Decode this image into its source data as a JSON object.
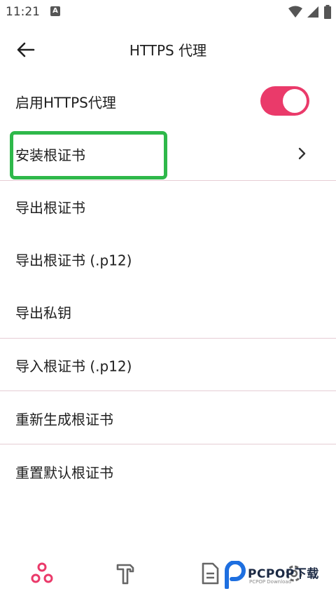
{
  "status": {
    "time": "11:21",
    "notif_letter": "A"
  },
  "header": {
    "title": "HTTPS 代理"
  },
  "settings": {
    "items": [
      {
        "label": "启用HTTPS代理"
      },
      {
        "label": "安装根证书"
      },
      {
        "label": "导出根证书"
      },
      {
        "label": "导出根证书 (.p12)"
      },
      {
        "label": "导出私钥"
      },
      {
        "label": "导入根证书 (.p12)"
      },
      {
        "label": "重新生成根证书"
      },
      {
        "label": "重置默认根证书"
      }
    ],
    "toggle_state": "on"
  },
  "colors": {
    "accent": "#ea3a6a",
    "highlight": "#2eb84a",
    "divider": "#e6cdd4"
  },
  "watermark": {
    "brand": "PCPOP下载",
    "sub": "PCPOP Download"
  }
}
